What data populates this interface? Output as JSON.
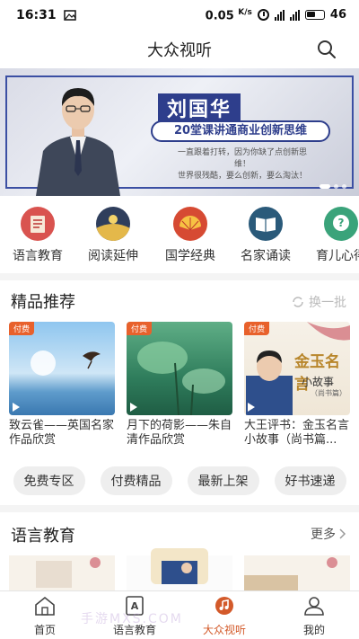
{
  "status_bar": {
    "time": "16:31",
    "speed": "0.05",
    "speed_unit": "K/s",
    "battery": "46"
  },
  "header": {
    "title": "大众视听",
    "search_icon": "search-icon"
  },
  "banner": {
    "name": "刘国华",
    "headline": "20堂课讲通商业创新思维",
    "subline_1": "一直跟着打转，因为你缺了点创新思维！",
    "subline_2": "世界很残酷，要么创新，要么淘汰！"
  },
  "categories": [
    {
      "label": "语言教育",
      "icon": "book-icon",
      "color": "#d9534f"
    },
    {
      "label": "阅读延伸",
      "icon": "moon-icon",
      "color": "#2f3e5c"
    },
    {
      "label": "国学经典",
      "icon": "fan-icon",
      "color": "#d64a33"
    },
    {
      "label": "名家诵读",
      "icon": "open-book-icon",
      "color": "#2a5a7a"
    },
    {
      "label": "育儿心得",
      "icon": "question-icon",
      "color": "#3aa37a"
    }
  ],
  "premium": {
    "title": "精品推荐",
    "refresh_label": "换一批",
    "items": [
      {
        "tag": "付费",
        "title": "致云雀——英国名家作品欣赏"
      },
      {
        "tag": "付费",
        "title": "月下的荷影——朱自清作品欣赏"
      },
      {
        "tag": "付费",
        "title": "大王评书：金玉名言小故事（尚书篇..."
      }
    ],
    "cover3_text_1": "金玉名言",
    "cover3_text_2": "小故事",
    "cover3_text_3": "（尚书篇）"
  },
  "pills": [
    "免费专区",
    "付费精品",
    "最新上架",
    "好书速递"
  ],
  "language_section": {
    "title": "语言教育",
    "more_label": "更多"
  },
  "bottom_nav": [
    {
      "label": "首页",
      "icon": "home-icon"
    },
    {
      "label": "语言教育",
      "icon": "language-icon"
    },
    {
      "label": "大众视听",
      "icon": "audio-icon",
      "active": true
    },
    {
      "label": "我的",
      "icon": "profile-icon"
    }
  ],
  "watermark": "手游MXS.COM",
  "colors": {
    "accent": "#d35a2a",
    "banner_blue": "#2e3e8c",
    "tag_orange": "#e8612c"
  }
}
